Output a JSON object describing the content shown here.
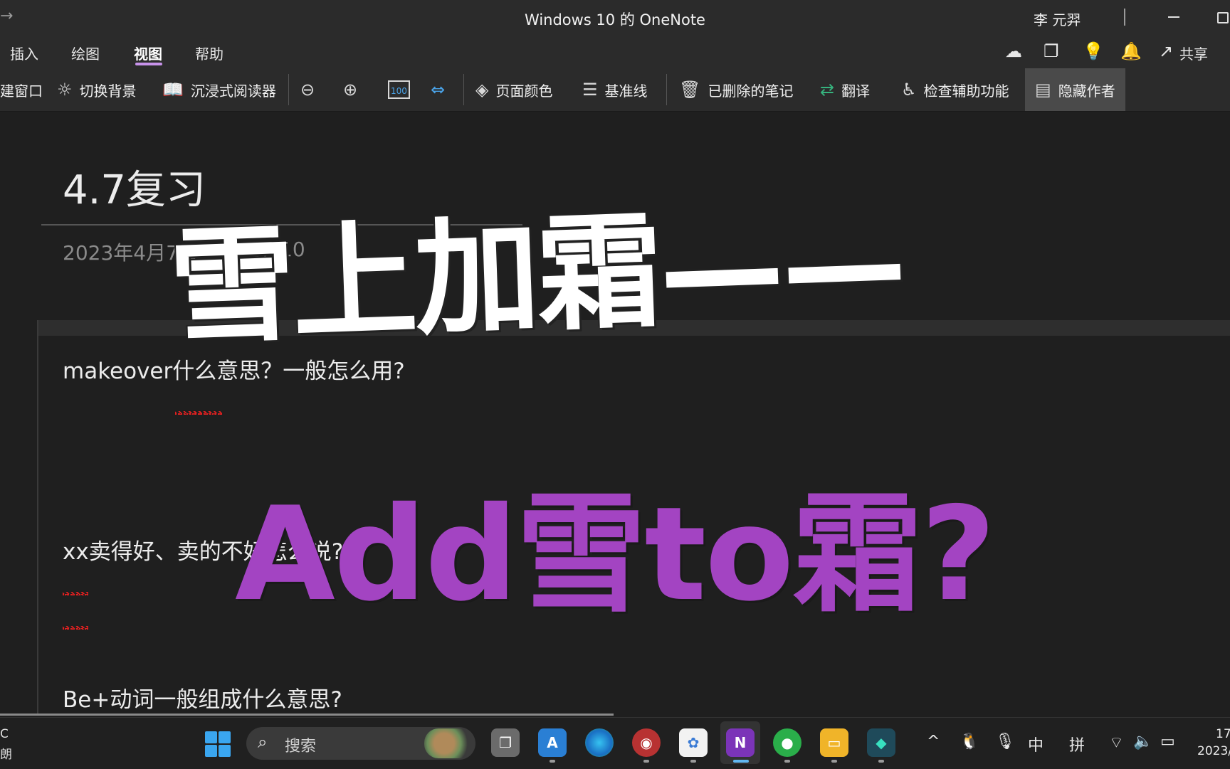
{
  "window": {
    "title": "Windows 10 的 OneNote",
    "user": "李 元羿",
    "back_icon": "arrow-left-icon"
  },
  "menu": {
    "items": [
      "插入",
      "绘图",
      "视图",
      "帮助"
    ],
    "active": "视图",
    "share_label": "共享"
  },
  "ribbon": {
    "new_window": "建窗口",
    "toggle_background": "切换背景",
    "immersive_reader": "沉浸式阅读器",
    "page_color": "页面颜色",
    "rule_lines": "基准线",
    "deleted_notes": "已删除的笔记",
    "translate": "翻译",
    "check_accessibility": "检查辅助功能",
    "hide_authors": "隐藏作者",
    "zoom_100_icon_text": "100"
  },
  "page": {
    "title": "4.7复习",
    "date": "2023年4月7日",
    "time_partial": "17:10",
    "notes": [
      "makeover什么意思？一般怎么用?",
      "xx卖得好、卖的不好怎么说?",
      "Be+动词一般组成什么意思?"
    ]
  },
  "overlay": {
    "line1": "雪上加霜——",
    "line2": "Add雪to霜?",
    "line2_color": "#a344c2"
  },
  "taskbar": {
    "weather_temp": "C",
    "weather_desc": "朗",
    "search_label": "搜索",
    "ime_mode": "中",
    "ime_input": "拼",
    "clock_time": "17",
    "clock_date": "2023/"
  }
}
